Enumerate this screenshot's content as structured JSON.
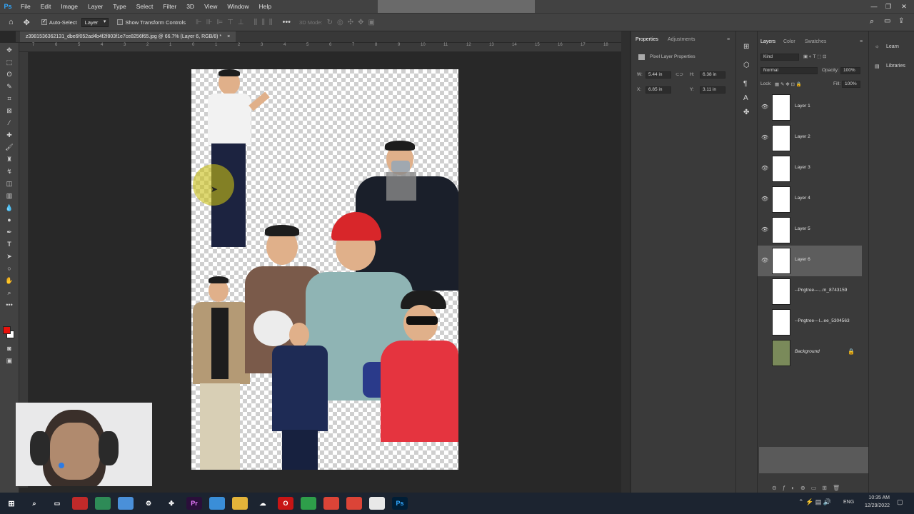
{
  "menu": [
    "File",
    "Edit",
    "Image",
    "Layer",
    "Type",
    "Select",
    "Filter",
    "3D",
    "View",
    "Window",
    "Help"
  ],
  "app_logo": "Ps",
  "options": {
    "auto_select_label": "Auto-Select",
    "auto_select_value": "Layer",
    "show_transform_label": "Show Transform Controls",
    "mode_3d_label": "3D Mode:"
  },
  "document_tab": "z3981536362131_dbe6f052ad4b4f2f803f1e7ce8256f65.jpg @ 66.7% (Layer 6, RGB/8) *",
  "ruler_h": [
    "7",
    "6",
    "5",
    "4",
    "3",
    "2",
    "1",
    "0",
    "1",
    "2",
    "3",
    "4",
    "5",
    "6",
    "7",
    "8",
    "9",
    "10",
    "11",
    "12",
    "13",
    "14",
    "15",
    "16",
    "17",
    "18"
  ],
  "properties": {
    "tab_active": "Properties",
    "tab_other": "Adjustments",
    "section": "Pixel Layer Properties",
    "w_label": "W:",
    "w_value": "5.44 in",
    "h_label": "H:",
    "h_value": "6.38 in",
    "x_label": "X:",
    "x_value": "6.85 in",
    "y_label": "Y:",
    "y_value": "3.11 in"
  },
  "layers_panel": {
    "tabs": [
      "Layers",
      "Color",
      "Swatches"
    ],
    "filter_kind": "Kind",
    "blend_mode": "Normal",
    "opacity_label": "Opacity:",
    "opacity_value": "100%",
    "lock_label": "Lock:",
    "fill_label": "Fill:",
    "fill_value": "100%",
    "layers": [
      {
        "name": "Layer 1",
        "visible": true,
        "selected": false
      },
      {
        "name": "Layer 2",
        "visible": true,
        "selected": false
      },
      {
        "name": "Layer 3",
        "visible": true,
        "selected": false
      },
      {
        "name": "Layer 4",
        "visible": true,
        "selected": false
      },
      {
        "name": "Layer 5",
        "visible": true,
        "selected": false
      },
      {
        "name": "Layer 6",
        "visible": true,
        "selected": true
      },
      {
        "name": "--Pngtree---...m_8743159",
        "visible": false,
        "selected": false
      },
      {
        "name": "--Pngtree---l...ee_5304563",
        "visible": false,
        "selected": false
      },
      {
        "name": "Background",
        "visible": false,
        "selected": false
      }
    ]
  },
  "right_panel": {
    "learn": "Learn",
    "libraries": "Libraries"
  },
  "taskbar": {
    "time": "10:35 AM",
    "date": "12/29/2022",
    "lang": "ENG"
  },
  "colors": {
    "accent": "#31a8ff",
    "foreground": "#e8120c",
    "background": "#ffffff"
  }
}
